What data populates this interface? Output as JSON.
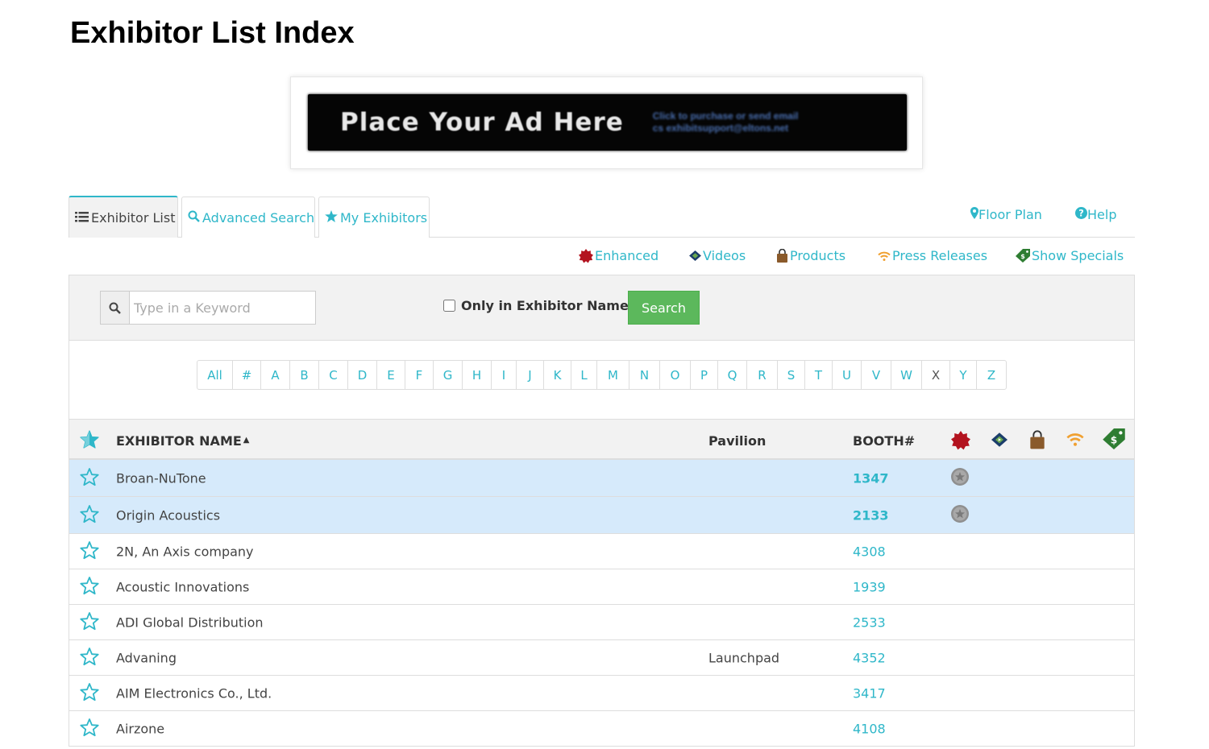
{
  "page": {
    "title": "Exhibitor List Index"
  },
  "ad": {
    "headline": "Place Your Ad Here",
    "subtext_line1": "Click to purchase or send email",
    "subtext_line2": "cs exhibitsupport@eltons.net"
  },
  "tabs": [
    {
      "label": "Exhibitor List",
      "icon": "list-icon"
    },
    {
      "label": "Advanced Search",
      "icon": "search-icon"
    },
    {
      "label": "My Exhibitors",
      "icon": "star-icon"
    }
  ],
  "header_links": {
    "floor_plan": "Floor Plan",
    "help": "Help"
  },
  "legend": {
    "enhanced": "Enhanced",
    "videos": "Videos",
    "products": "Products",
    "press_releases": "Press Releases",
    "show_specials": "Show Specials"
  },
  "search": {
    "placeholder": "Type in a Keyword",
    "checkbox_label": "Only in Exhibitor Name",
    "button_label": "Search"
  },
  "alphabet": [
    "All",
    "#",
    "A",
    "B",
    "C",
    "D",
    "E",
    "F",
    "G",
    "H",
    "I",
    "J",
    "K",
    "L",
    "M",
    "N",
    "O",
    "P",
    "Q",
    "R",
    "S",
    "T",
    "U",
    "V",
    "W",
    "X",
    "Y",
    "Z"
  ],
  "table": {
    "headers": {
      "name": "EXHIBITOR NAME",
      "pavilion": "Pavilion",
      "booth": "BOOTH#"
    },
    "rows": [
      {
        "name": "Broan-NuTone",
        "pavilion": "",
        "booth": "1347",
        "featured": true
      },
      {
        "name": "Origin Acoustics",
        "pavilion": "",
        "booth": "2133",
        "featured": true
      },
      {
        "name": "2N, An Axis company",
        "pavilion": "",
        "booth": "4308",
        "featured": false
      },
      {
        "name": "Acoustic Innovations",
        "pavilion": "",
        "booth": "1939",
        "featured": false
      },
      {
        "name": "ADI Global Distribution",
        "pavilion": "",
        "booth": "2533",
        "featured": false
      },
      {
        "name": "Advaning",
        "pavilion": "Launchpad",
        "booth": "4352",
        "featured": false
      },
      {
        "name": "AIM Electronics Co., Ltd.",
        "pavilion": "",
        "booth": "3417",
        "featured": false
      },
      {
        "name": "Airzone",
        "pavilion": "",
        "booth": "4108",
        "featured": false
      }
    ]
  },
  "colors": {
    "accent": "#2fb7c9",
    "featured_row": "#d6eafb",
    "search_button": "#5cb85c"
  }
}
